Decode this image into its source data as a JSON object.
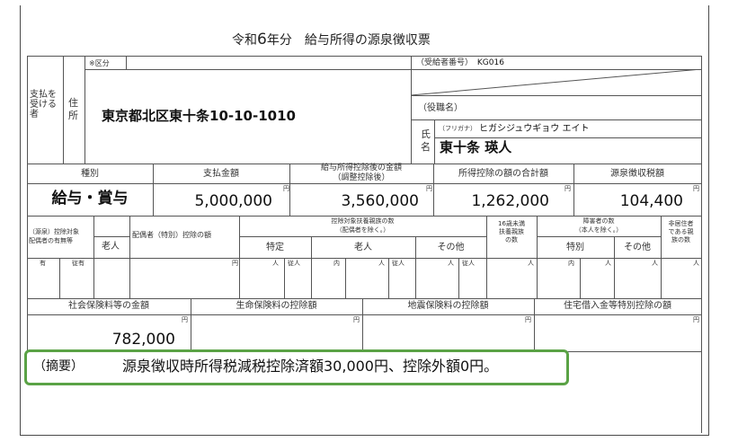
{
  "title": {
    "pre": "令和",
    "year": "6",
    "post": "年分　給与所得の源泉徴収票"
  },
  "payer_label": "支払を受ける者",
  "address_label": "住所",
  "kubun_label": "※区分",
  "address": "東京都北区東十条10-10-1010",
  "recipient_number_label": "（受給者番号）",
  "recipient_number": "KG016",
  "position_label": "（役職名）",
  "name_label": "氏名",
  "furigana_label": "（フリガナ）",
  "furigana": "ヒガシジュウギョウ エイト",
  "name": "東十条 瑛人",
  "headers": {
    "shubetsu": "種別",
    "shiharai": "支払金額",
    "kyuyo_line1": "給与所得控除後の金額",
    "kyuyo_line2": "（調整控除後）",
    "shotoku_kojo": "所得控除の額の合計額",
    "gensen": "源泉徴収税額"
  },
  "values": {
    "shubetsu": "給与・賞与",
    "shiharai": "5,000,000",
    "kyuyo": "3,560,000",
    "shotoku_kojo": "1,262,000",
    "gensen": "104,400"
  },
  "yen": "円",
  "row3": {
    "spouse_line1": "（源泉）控除対象",
    "spouse_line2": "配偶者の有無等",
    "rojin": "老人",
    "spouse_special": "配偶者（特別）控除の額",
    "dep_line1": "控除対象扶養親族の数",
    "dep_line2": "（配偶者を除く。）",
    "tokutei": "特定",
    "rojin2": "老人",
    "sonota": "その他",
    "u16_line1": "16歳未満",
    "u16_line2": "扶養親族",
    "u16_line3": "の数",
    "dis_line1": "障害者の数",
    "dis_line2": "（本人を除く。）",
    "tokubetsu": "特別",
    "sonota2": "その他",
    "nonres_line1": "非居住者",
    "nonres_line2": "である親",
    "nonres_line3": "族の数",
    "ari": "有",
    "juu": "従有",
    "nin": "人",
    "juunin": "従人",
    "nai": "内"
  },
  "row4": {
    "shakai": "社会保険料等の金額",
    "seimei": "生命保険料の控除額",
    "jishin": "地震保険料の控除額",
    "jutaku": "住宅借入金等特別控除の額",
    "shakai_value": "782,000"
  },
  "tekiyo": {
    "label": "（摘要）",
    "text": "源泉徴収時所得税減税控除済額30,000円、控除外額0円。"
  },
  "colors": {
    "highlight_border": "#5aa245",
    "frame": "#4a4a4a",
    "line": "#555555"
  }
}
